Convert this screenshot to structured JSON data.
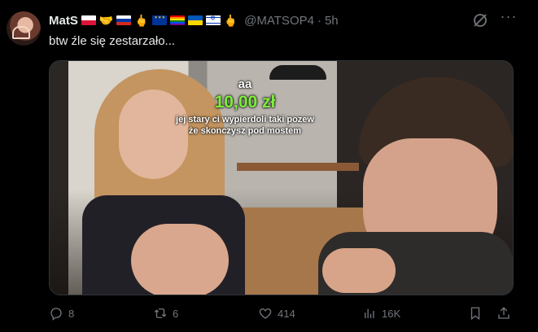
{
  "tweet": {
    "author_name": "MatS",
    "handle": "@MATSOP4",
    "separator": "·",
    "time": "5h",
    "text": "btw źle się zestarzało..."
  },
  "header_icons": [
    "flag-poland",
    "handshake-emoji",
    "flag-russia",
    "middle-finger-emoji",
    "flag-eu",
    "rainbow-flag",
    "flag-ukraine",
    "flag-israel",
    "middle-finger-emoji"
  ],
  "media": {
    "overlay_user": "aa",
    "overlay_amount": "10,00 zł",
    "overlay_message": "jej stary ci wypierdoli taki pozew że skonczysz pod mostem"
  },
  "actions": {
    "replies": "8",
    "reposts": "6",
    "likes": "414",
    "views": "16K"
  },
  "colors": {
    "background": "#000000",
    "text": "#e7e9ea",
    "muted": "#71767b",
    "donation_green": "#7cf03a"
  }
}
